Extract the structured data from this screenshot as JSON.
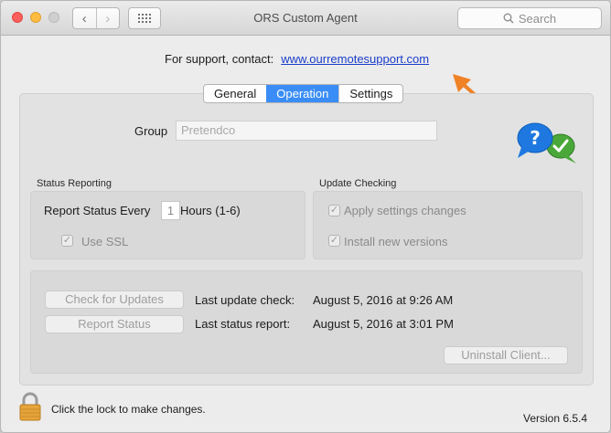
{
  "window": {
    "title": "ORS Custom Agent",
    "search_placeholder": "Search"
  },
  "support": {
    "prefix": "For support, contact:",
    "link": "www.ourremotesupport.com"
  },
  "tabs": [
    {
      "label": "General",
      "active": false
    },
    {
      "label": "Operation",
      "active": true
    },
    {
      "label": "Settings",
      "active": false
    }
  ],
  "group": {
    "label": "Group",
    "placeholder": "Pretendco"
  },
  "status_reporting": {
    "title": "Status Reporting",
    "report_label": "Report Status Every",
    "hours_value": "1",
    "hours_suffix": "Hours (1-6)",
    "use_ssl": "Use SSL"
  },
  "update_checking": {
    "title": "Update Checking",
    "apply_settings": "Apply settings changes",
    "install_versions": "Install new versions"
  },
  "actions": {
    "check_updates": "Check for Updates",
    "report_status": "Report Status",
    "last_update_label": "Last update check:",
    "last_update_value": "August 5, 2016 at 9:26 AM",
    "last_report_label": "Last status report:",
    "last_report_value": "August 5, 2016 at 3:01 PM",
    "uninstall": "Uninstall Client..."
  },
  "footer": {
    "lock_text": "Click the lock to make changes.",
    "version": "Version 6.5.4"
  },
  "colors": {
    "accent": "#3a8df6",
    "link": "#1a3eca",
    "arrow": "#f08226"
  }
}
